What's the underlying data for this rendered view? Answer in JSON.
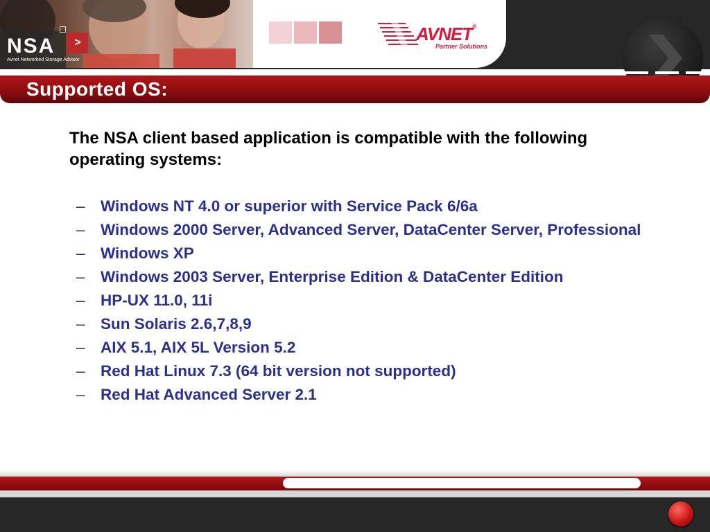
{
  "header": {
    "logo_text": "NSA",
    "logo_subtitle": "Avnet Networked Storage Advisor",
    "logo_arrow": ">",
    "brand_name": "AVNET",
    "brand_registered": "®",
    "brand_subtitle": "Partner Solutions"
  },
  "slide": {
    "title": "Supported OS:",
    "intro": "The NSA client based application is compatible with the following operating systems:",
    "bullet_marker": "–",
    "items": [
      "Windows NT 4.0 or superior with Service Pack 6/6a",
      "Windows 2000 Server, Advanced Server, DataCenter Server, Professional",
      "Windows XP",
      "Windows 2003 Server, Enterprise Edition & DataCenter Edition",
      "HP-UX 11.0, 11i",
      "Sun Solaris 2.6,7,8,9",
      "AIX 5.1, AIX 5L Version 5.2",
      "Red Hat Linux 7.3 (64 bit version not supported)",
      "Red Hat Advanced Server 2.1"
    ]
  },
  "icons": {
    "header_chevron": "chevron-right-icon",
    "footer_button": "next-slide-button"
  },
  "colors": {
    "accent_red": "#a8121a",
    "list_text": "#2a2f90",
    "brand_red": "#d8183b",
    "dark_bg": "#262626"
  }
}
